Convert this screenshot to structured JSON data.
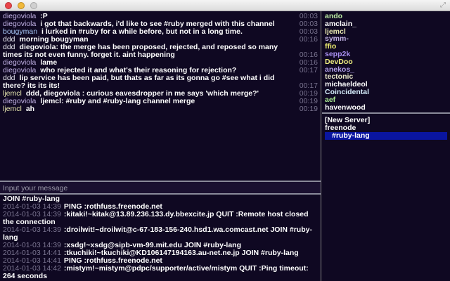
{
  "window": {
    "fullscreen_icon": "fullscreen-icon"
  },
  "messages": [
    {
      "nick": "diegoviola",
      "text": ":P",
      "time": "00:03",
      "color": "#c2b2e6"
    },
    {
      "nick": "diegoviola",
      "text": "i got that backwards, i'd like to see #ruby merged with this channel",
      "time": "00:03",
      "color": "#c2b2e6"
    },
    {
      "nick": "bougyman",
      "text": "i lurked in #ruby for a while before, but not in a long time.",
      "time": "00:03",
      "color": "#a8c8f8"
    },
    {
      "nick": "ddd",
      "text": "morning bougyman",
      "time": "00:16",
      "color": "#e8e8f0"
    },
    {
      "nick": "ddd",
      "text": "diegoviola: the merge has been proposed, rejected, and reposed so many times its not even funny. forget it. aint happening",
      "time": "00:16",
      "color": "#e8e8f0"
    },
    {
      "nick": "diegoviola",
      "text": "lame",
      "time": "00:16",
      "color": "#c2b2e6"
    },
    {
      "nick": "diegoviola",
      "text": "who rejected it and what's their reasoning for rejection?",
      "time": "00:17",
      "color": "#c2b2e6"
    },
    {
      "nick": "ddd",
      "text": "lip service has been paid, but thats as far as its gonna go #see what i did there? its its its!",
      "time": "00:17",
      "color": "#e8e8f0"
    },
    {
      "nick": "ljemcl",
      "text": "ddd, diegoviola : curious eavesdropper in me says 'which merge?'",
      "time": "00:19",
      "color": "#e8e8b0"
    },
    {
      "nick": "diegoviola",
      "text": "ljemcl: #ruby and #ruby-lang channel merge",
      "time": "00:19",
      "color": "#c2b2e6"
    },
    {
      "nick": "ljemcl",
      "text": "ah",
      "time": "00:19",
      "color": "#e8e8b0"
    }
  ],
  "input": {
    "placeholder": "Input your message"
  },
  "log": [
    {
      "ts": "",
      "text": "JOIN #ruby-lang"
    },
    {
      "ts": "2014-01-03 14:39",
      "text": "PING :rothfuss.freenode.net"
    },
    {
      "ts": "2014-01-03 14:39",
      "text": ":kitaki!~kitak@13.89.236.133.dy.bbexcite.jp QUIT :Remote host closed the connection"
    },
    {
      "ts": "2014-01-03 14:39",
      "text": ":droilwit!~droilwit@c-67-183-156-240.hsd1.wa.comcast.net JOIN #ruby-lang"
    },
    {
      "ts": "2014-01-03 14:39",
      "text": ":xsdg!~xsdg@sipb-vm-99.mit.edu JOIN #ruby-lang"
    },
    {
      "ts": "2014-01-03 14:41",
      "text": ":tkuchiki!~tkuchiki@KD106147194163.au-net.ne.jp JOIN #ruby-lang"
    },
    {
      "ts": "2014-01-03 14:41",
      "text": "PING :rothfuss.freenode.net"
    },
    {
      "ts": "2014-01-03 14:42",
      "text": ":mistym!~mistym@pdpc/supporter/active/mistym QUIT :Ping timeout: 264 seconds"
    }
  ],
  "nicks": [
    {
      "name": "ando",
      "color": "#b8e8a0"
    },
    {
      "name": "amclain_",
      "color": "#ffffff"
    },
    {
      "name": "ljemcl",
      "color": "#e8e8b0"
    },
    {
      "name": "symm-",
      "color": "#c2b2e6"
    },
    {
      "name": "ffio",
      "color": "#f0f070"
    },
    {
      "name": "sepp2k",
      "color": "#a890f0"
    },
    {
      "name": "DevDoo",
      "color": "#f0f080"
    },
    {
      "name": "anekos_",
      "color": "#b0a0e8"
    },
    {
      "name": "tectonic",
      "color": "#e8e8c8"
    },
    {
      "name": "michaeldeol",
      "color": "#ffffff"
    },
    {
      "name": "Coincidental",
      "color": "#d8f0ff"
    },
    {
      "name": "aef",
      "color": "#a8e890"
    },
    {
      "name": "havenwood",
      "color": "#ffffff"
    }
  ],
  "tree": {
    "new_server": "[New Server]",
    "server": "freenode",
    "channel": "#ruby-lang"
  }
}
